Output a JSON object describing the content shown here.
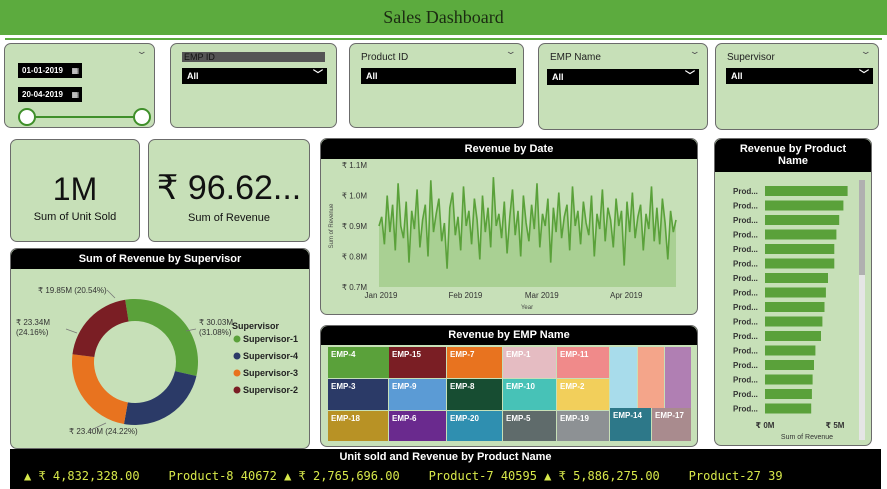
{
  "header": {
    "title": "Sales Dashboard"
  },
  "date_slicer": {
    "start": "01-01-2019",
    "end": "20-04-2019",
    "calendar_icon": "calendar-icon"
  },
  "slicers": [
    {
      "title": "EMP ID",
      "value": "All"
    },
    {
      "title": "Product ID",
      "value": "All"
    },
    {
      "title": "EMP Name",
      "value": "All"
    },
    {
      "title": "Supervisor",
      "value": "All"
    }
  ],
  "kpis": {
    "units": {
      "value": "1M",
      "label": "Sum of Unit Sold"
    },
    "revenue": {
      "value": "₹ 96.62...",
      "label": "Sum of Revenue"
    }
  },
  "revenue_by_date": {
    "title": "Revenue by Date",
    "ylabel": "Sum of Revenue",
    "xlabel": "Year",
    "yticks": [
      "₹ 1.1M",
      "₹ 1.0M",
      "₹ 0.9M",
      "₹ 0.8M",
      "₹ 0.7M"
    ],
    "xticks": [
      "Jan 2019",
      "Feb 2019",
      "Mar 2019",
      "Apr 2019"
    ]
  },
  "supervisor_donut": {
    "title": "Sum of Revenue by Supervisor",
    "legend_title": "Supervisor",
    "labels": [
      "₹ 30.03M (31.08%)",
      "₹ 23.40M (24.22%)",
      "₹ 23.34M (24.16%)",
      "₹ 19.85M (20.54%)"
    ]
  },
  "emp_treemap": {
    "title": "Revenue by EMP Name"
  },
  "product_bars": {
    "title_line1": "Revenue by Product",
    "title_line2": "Name",
    "bar_label": "Prod...",
    "xticks": [
      "₹ 0M",
      "₹ 5M"
    ],
    "xlabel": "Sum of Revenue"
  },
  "ticker": {
    "title": "Unit sold and Revenue by Product Name",
    "text": "▲ ₹ 4,832,328.00    Product-8 40672 ▲ ₹ 2,765,696.00    Product-7 40595 ▲ ₹ 5,886,275.00    Product-27 39"
  },
  "chart_data": [
    {
      "type": "line",
      "title": "Revenue by Date",
      "xlabel": "Year",
      "ylabel": "Sum of Revenue",
      "x_range": [
        "2019-01-01",
        "2019-04-20"
      ],
      "ylim": [
        0.7,
        1.1
      ],
      "y_unit": "₹ M",
      "values": [
        0.9,
        0.93,
        0.84,
        1.0,
        0.88,
        0.97,
        0.82,
        1.04,
        0.9,
        0.86,
        0.98,
        0.78,
        0.95,
        0.89,
        1.02,
        0.83,
        0.92,
        0.97,
        0.8,
        1.05,
        0.88,
        0.94,
        0.99,
        0.85,
        0.91,
        0.76,
        0.96,
        1.01,
        0.87,
        0.93,
        0.82,
        1.03,
        0.9,
        0.95,
        0.84,
        0.99,
        0.92,
        0.79,
        1.0,
        0.88,
        0.96,
        0.83,
        1.06,
        0.9,
        0.94,
        0.86,
        0.98,
        0.81,
        0.93,
        1.02,
        0.87,
        0.95,
        0.8,
        1.0,
        0.91,
        0.85,
        0.97,
        0.89,
        1.04,
        0.83,
        0.94,
        0.9,
        0.99,
        0.78,
        0.96,
        0.88,
        1.01,
        0.86,
        0.93,
        0.97,
        0.82,
        1.03,
        0.9,
        0.95,
        0.84,
        0.98,
        0.91,
        0.87,
        1.0,
        0.8,
        0.94,
        0.89,
        1.02,
        0.85,
        0.96,
        0.92,
        0.83,
        0.99,
        0.9,
        0.95,
        0.77,
        0.98,
        0.88,
        1.01,
        0.86,
        0.93,
        0.97,
        0.82,
        0.94,
        0.89,
        1.03,
        0.85,
        0.96,
        0.84,
        0.99,
        0.91,
        0.79,
        0.95,
        0.88,
        0.92
      ],
      "line_color": "#5aa13a"
    },
    {
      "type": "pie",
      "title": "Sum of Revenue by Supervisor",
      "series": [
        {
          "name": "Supervisor-1",
          "value": 30.03,
          "percent": 31.08,
          "color": "#5aa13a"
        },
        {
          "name": "Supervisor-4",
          "value": 23.4,
          "percent": 24.22,
          "color": "#2b3a67"
        },
        {
          "name": "Supervisor-3",
          "value": 23.34,
          "percent": 24.16,
          "color": "#e8731f"
        },
        {
          "name": "Supervisor-2",
          "value": 19.85,
          "percent": 20.54,
          "color": "#7a1e24"
        }
      ]
    },
    {
      "type": "heatmap",
      "title": "Revenue by EMP Name",
      "cells": [
        {
          "name": "EMP-4",
          "color": "#5aa13a"
        },
        {
          "name": "EMP-15",
          "color": "#7a1e24"
        },
        {
          "name": "EMP-7",
          "color": "#e8731f"
        },
        {
          "name": "EMP-1",
          "color": "#e5bcc2"
        },
        {
          "name": "EMP-11",
          "color": "#f08a8a"
        },
        {
          "name": "",
          "color": "#a8dceb"
        },
        {
          "name": "",
          "color": "#f4a58a"
        },
        {
          "name": "",
          "color": "#b07fb3"
        },
        {
          "name": "EMP-3",
          "color": "#2b3a67"
        },
        {
          "name": "EMP-9",
          "color": "#5b9bd5"
        },
        {
          "name": "EMP-8",
          "color": "#174d32"
        },
        {
          "name": "EMP-10",
          "color": "#47c2b7"
        },
        {
          "name": "EMP-2",
          "color": "#f2cf5b"
        },
        {
          "name": "EMP-18",
          "color": "#b89225"
        },
        {
          "name": "EMP-6",
          "color": "#6a2a8e"
        },
        {
          "name": "EMP-20",
          "color": "#2f8fb0"
        },
        {
          "name": "EMP-5",
          "color": "#5f6b6b"
        },
        {
          "name": "EMP-19",
          "color": "#8d9194"
        },
        {
          "name": "EMP-14",
          "color": "#2d7889"
        },
        {
          "name": "EMP-17",
          "color": "#a98b8e"
        }
      ]
    },
    {
      "type": "bar",
      "title": "Revenue by Product Name",
      "orientation": "horizontal",
      "xlabel": "Sum of Revenue",
      "xlim": [
        0,
        5.6
      ],
      "x_unit": "₹ M",
      "categories": [
        "Prod...",
        "Prod...",
        "Prod...",
        "Prod...",
        "Prod...",
        "Prod...",
        "Prod...",
        "Prod...",
        "Prod...",
        "Prod...",
        "Prod...",
        "Prod...",
        "Prod...",
        "Prod...",
        "Prod...",
        "Prod..."
      ],
      "values": [
        5.9,
        5.6,
        5.3,
        5.1,
        4.95,
        4.95,
        4.5,
        4.35,
        4.25,
        4.1,
        4.0,
        3.6,
        3.5,
        3.4,
        3.35,
        3.3
      ],
      "color": "#5aa13a"
    }
  ]
}
